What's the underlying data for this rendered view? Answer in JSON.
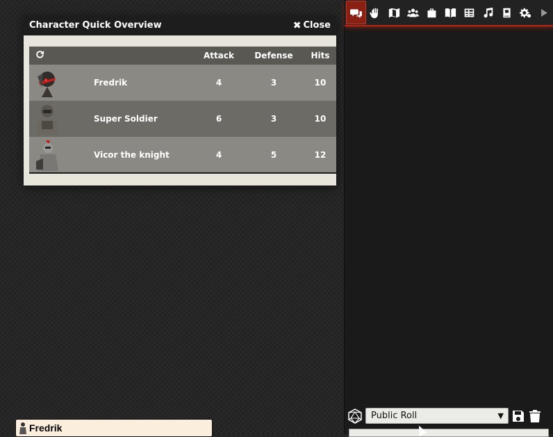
{
  "dialog": {
    "title": "Character Quick Overview",
    "close_label": "Close",
    "columns": [
      "Attack",
      "Defense",
      "Hits"
    ],
    "rows": [
      {
        "name": "Fredrik",
        "attack": "4",
        "defense": "3",
        "hits": "10",
        "portrait": "red-masked-warrior-portrait"
      },
      {
        "name": "Super Soldier",
        "attack": "6",
        "defense": "3",
        "hits": "10",
        "portrait": "armored-soldier-portrait"
      },
      {
        "name": "Vicor the knight",
        "attack": "4",
        "defense": "5",
        "hits": "12",
        "portrait": "knight-portrait"
      }
    ]
  },
  "sidebar": {
    "tabs": [
      "chat-icon",
      "hand-icon",
      "map-icon",
      "users-icon",
      "briefcase-icon",
      "book-icon",
      "table-icon",
      "music-icon",
      "journal-icon",
      "settings-icon",
      "arrow-right-icon"
    ],
    "roll_mode": "Public Roll",
    "accent_color": "#b32718"
  },
  "token": {
    "name": "Fredrik"
  }
}
